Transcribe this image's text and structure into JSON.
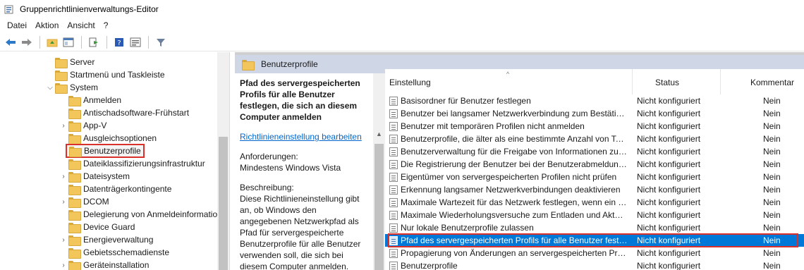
{
  "window": {
    "title": "Gruppenrichtlinienverwaltungs-Editor"
  },
  "menu": [
    "Datei",
    "Aktion",
    "Ansicht",
    "?"
  ],
  "toolbar": {
    "icons": [
      "back-arrow-icon",
      "forward-arrow-icon",
      "up-folder-icon",
      "show-hide-tree-icon",
      "export-list-icon",
      "help-icon",
      "properties-view-icon",
      "filter-icon"
    ]
  },
  "tree": {
    "items": [
      {
        "label": "Server",
        "level": 1,
        "expander": ""
      },
      {
        "label": "Startmenü und Taskleiste",
        "level": 1,
        "expander": ""
      },
      {
        "label": "System",
        "level": 1,
        "expander": "expanded"
      },
      {
        "label": "Anmelden",
        "level": 2,
        "expander": ""
      },
      {
        "label": "Antischadsoftware-Frühstart",
        "level": 2,
        "expander": ""
      },
      {
        "label": "App-V",
        "level": 2,
        "expander": "collapsed"
      },
      {
        "label": "Ausgleichsoptionen",
        "level": 2,
        "expander": ""
      },
      {
        "label": "Benutzerprofile",
        "level": 2,
        "expander": "",
        "selected": true
      },
      {
        "label": "Dateiklassifizierungsinfrastruktur",
        "level": 2,
        "expander": ""
      },
      {
        "label": "Dateisystem",
        "level": 2,
        "expander": "collapsed"
      },
      {
        "label": "Datenträgerkontingente",
        "level": 2,
        "expander": ""
      },
      {
        "label": "DCOM",
        "level": 2,
        "expander": "collapsed"
      },
      {
        "label": "Delegierung von Anmeldeinformationen",
        "level": 2,
        "expander": ""
      },
      {
        "label": "Device Guard",
        "level": 2,
        "expander": ""
      },
      {
        "label": "Energieverwaltung",
        "level": 2,
        "expander": "collapsed"
      },
      {
        "label": "Gebietsschemadienste",
        "level": 2,
        "expander": ""
      },
      {
        "label": "Geräteinstallation",
        "level": 2,
        "expander": "collapsed"
      }
    ]
  },
  "header": {
    "title": "Benutzerprofile"
  },
  "description": {
    "policy_title": "Pfad des servergespeicherten Profils für alle Benutzer festlegen, die sich an diesem Computer anmelden",
    "edit_link": "Richtlinieneinstellung bearbeiten",
    "requirements_label": "Anforderungen:",
    "requirements_value": "Mindestens Windows Vista",
    "description_label": "Beschreibung:",
    "description_text": "Diese Richtlinieneinstellung gibt an, ob Windows den angegebenen Netzwerkpfad als Pfad für servergespeicherte Benutzerprofile für alle Benutzer verwenden soll, die sich bei diesem Computer anmelden."
  },
  "list": {
    "columns": {
      "setting": "Einstellung",
      "status": "Status",
      "comment": "Kommentar"
    },
    "rows": [
      {
        "name": "Basisordner für Benutzer festlegen",
        "status": "Nicht konfiguriert",
        "comment": "Nein"
      },
      {
        "name": "Benutzer bei langsamer Netzwerkverbindung zum Bestätigen auffordern",
        "status": "Nicht konfiguriert",
        "comment": "Nein"
      },
      {
        "name": "Benutzer mit temporären Profilen nicht anmelden",
        "status": "Nicht konfiguriert",
        "comment": "Nein"
      },
      {
        "name": "Benutzerprofile, die älter als eine bestimmte Anzahl von Tagen sind, löschen",
        "status": "Nicht konfiguriert",
        "comment": "Nein"
      },
      {
        "name": "Benutzerverwaltung für die Freigabe von Informationen zu Benutzern festlegen",
        "status": "Nicht konfiguriert",
        "comment": "Nein"
      },
      {
        "name": "Die Registrierung der Benutzer bei der Benutzerabmeldung nicht zwangsweise entladen",
        "status": "Nicht konfiguriert",
        "comment": "Nein"
      },
      {
        "name": "Eigentümer von servergespeicherten Profilen nicht prüfen",
        "status": "Nicht konfiguriert",
        "comment": "Nein"
      },
      {
        "name": "Erkennung langsamer Netzwerkverbindungen deaktivieren",
        "status": "Nicht konfiguriert",
        "comment": "Nein"
      },
      {
        "name": "Maximale Wartezeit für das Netzwerk festlegen, wenn ein Benutzer ein Profil hat",
        "status": "Nicht konfiguriert",
        "comment": "Nein"
      },
      {
        "name": "Maximale Wiederholungsversuche zum Entladen und Aktualisieren",
        "status": "Nicht konfiguriert",
        "comment": "Nein"
      },
      {
        "name": "Nur lokale Benutzerprofile zulassen",
        "status": "Nicht konfiguriert",
        "comment": "Nein"
      },
      {
        "name": "Pfad des servergespeicherten Profils für alle Benutzer festlegen",
        "status": "Nicht konfiguriert",
        "comment": "Nein",
        "selected": true
      },
      {
        "name": "Propagierung von Änderungen an servergespeicherten Profilen",
        "status": "Nicht konfiguriert",
        "comment": "Nein"
      },
      {
        "name": "Benutzerprofile",
        "status": "Nicht konfiguriert",
        "comment": "Nein"
      }
    ]
  }
}
